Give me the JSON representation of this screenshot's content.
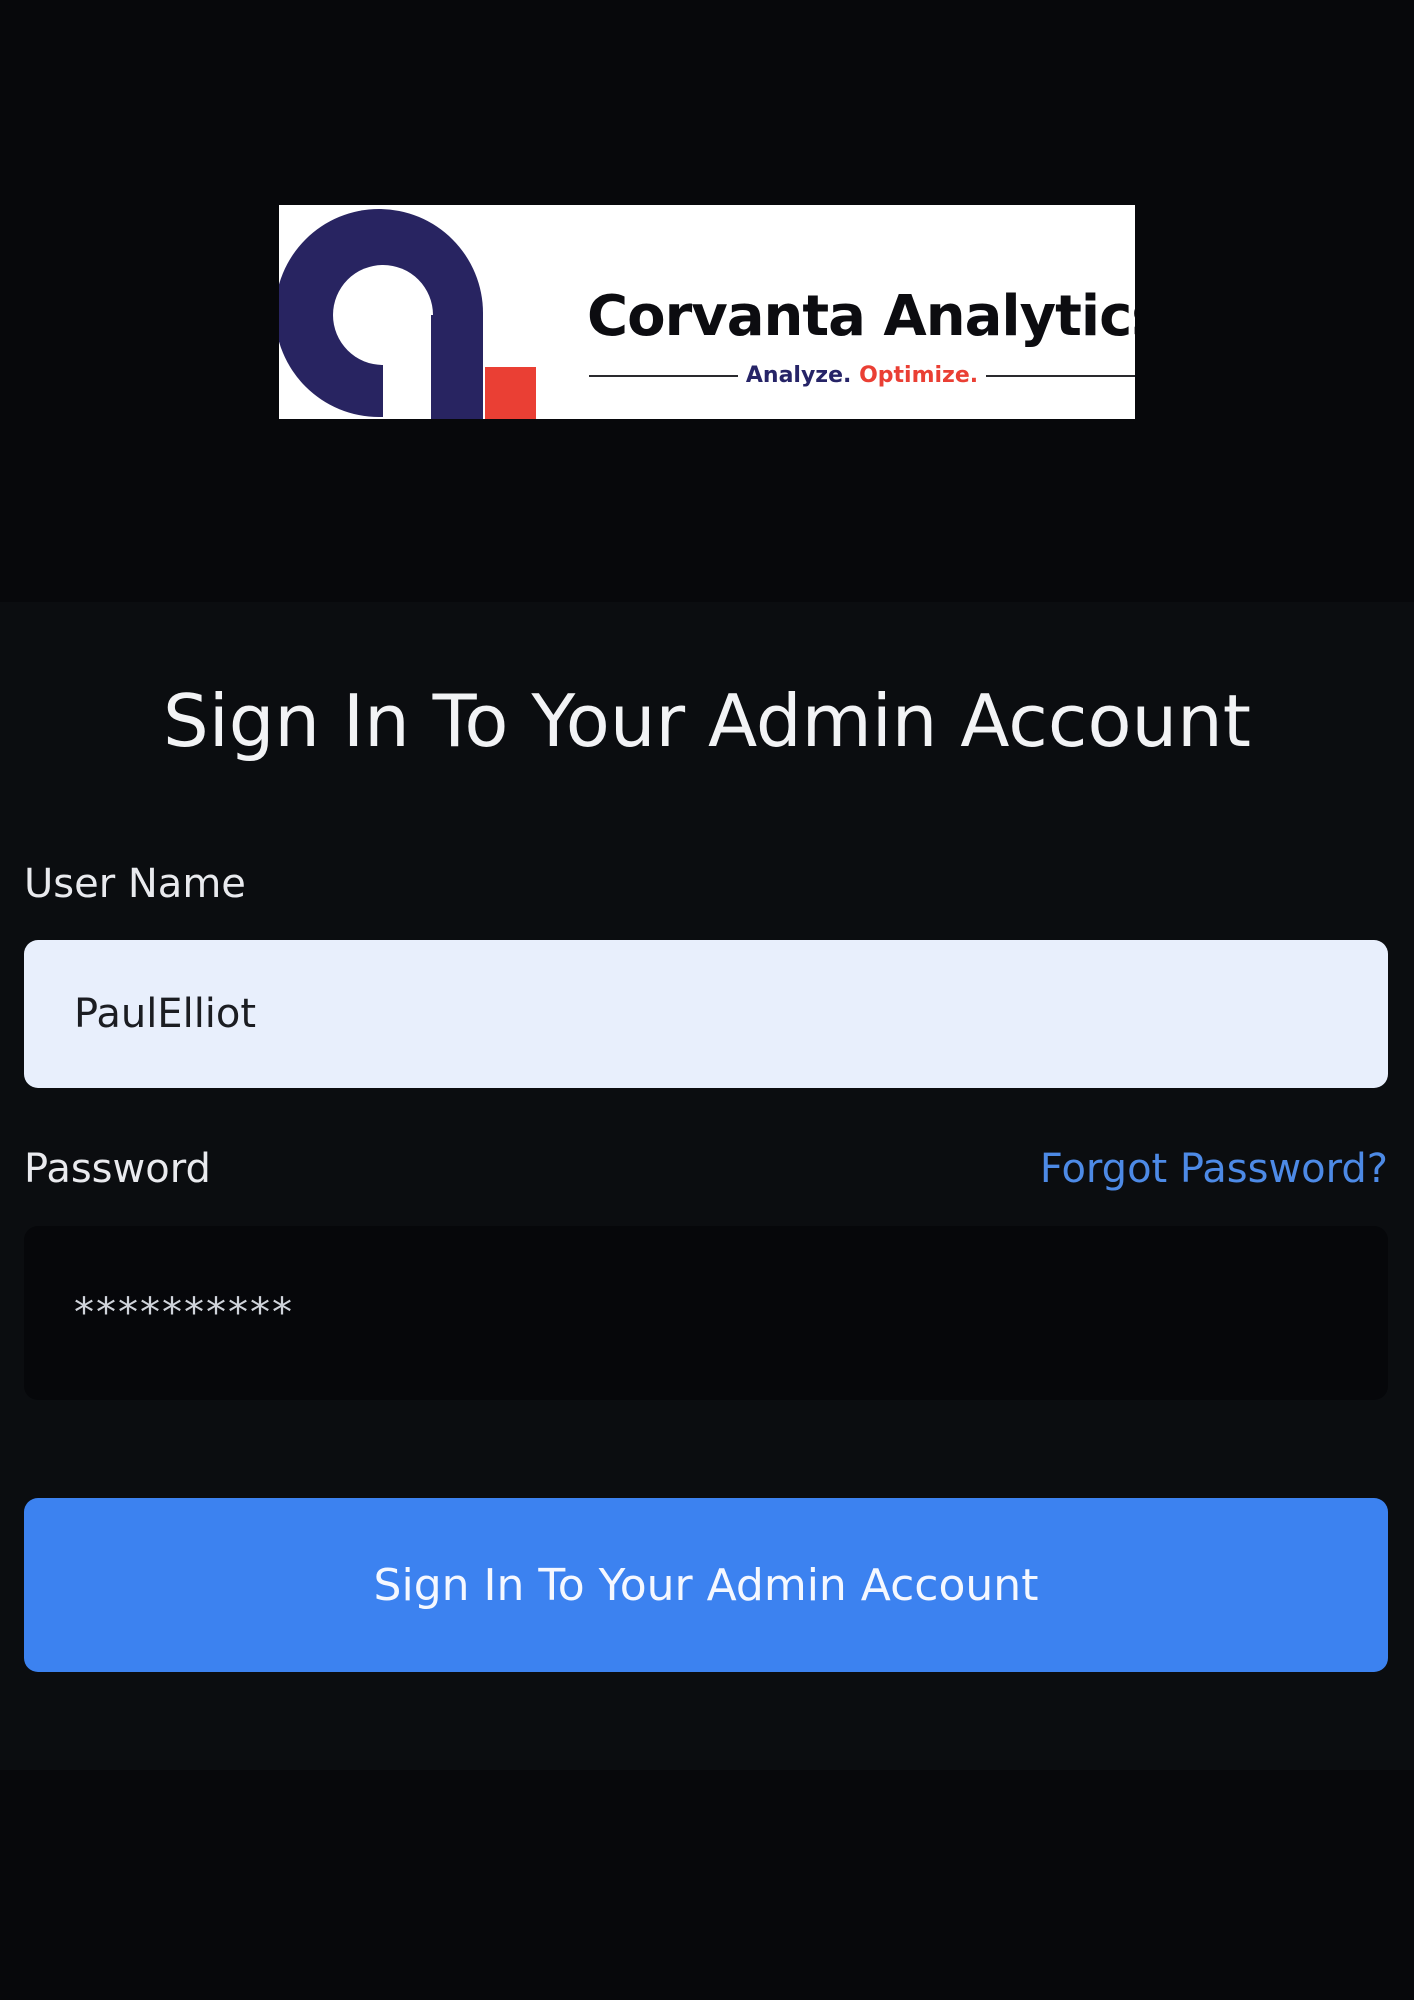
{
  "logo": {
    "name": "Corvanta Analytics",
    "tagline_part1": "Analyze.",
    "tagline_part2": "Optimize.",
    "colors": {
      "mark": "#282461",
      "accent": "#ea3f34"
    }
  },
  "page": {
    "title": "Sign In To Your Admin Account"
  },
  "form": {
    "username_label": "User Name",
    "username_value": "PaulElliot",
    "password_label": "Password",
    "forgot_link": "Forgot Password?",
    "password_display": "**********",
    "submit_label": "Sign In To Your Admin Account"
  },
  "theme": {
    "background": "#07080b",
    "panel": "#0b0d10",
    "primary": "#3c82f0",
    "link": "#4d8ae6"
  }
}
